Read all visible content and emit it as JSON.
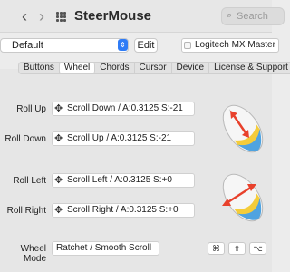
{
  "titlebar": {
    "back_glyph": "‹",
    "forward_glyph": "›",
    "app_name": "SteerMouse",
    "search_placeholder": "Search",
    "search_glyph": "⌕"
  },
  "profile": {
    "selected": "Default",
    "chevron_glyph": "⇕",
    "edit_label": "Edit",
    "device_name": "Logitech MX Master 2S (U..."
  },
  "tabs": [
    {
      "label": "Buttons"
    },
    {
      "label": "Wheel"
    },
    {
      "label": "Chords"
    },
    {
      "label": "Cursor"
    },
    {
      "label": "Device"
    },
    {
      "label": "License & Support"
    }
  ],
  "active_tab": "Wheel",
  "move_glyph": "✥",
  "rows": {
    "roll_up": {
      "label": "Roll Up",
      "action": "Scroll Down / A:0.3125 S:-21"
    },
    "roll_down": {
      "label": "Roll Down",
      "action": "Scroll Up / A:0.3125 S:-21"
    },
    "roll_left": {
      "label": "Roll Left",
      "action": "Scroll Left / A:0.3125 S:+0"
    },
    "roll_right": {
      "label": "Roll Right",
      "action": "Scroll Right / A:0.3125 S:+0"
    }
  },
  "wheel_mode": {
    "label": "Wheel Mode",
    "value": "Ratchet / Smooth Scroll"
  },
  "modifier_keys": [
    "⌘",
    "⇧",
    "⌥",
    "⌃"
  ],
  "colors": {
    "accent": "#2f7cf6",
    "arrow": "#e8412c"
  }
}
